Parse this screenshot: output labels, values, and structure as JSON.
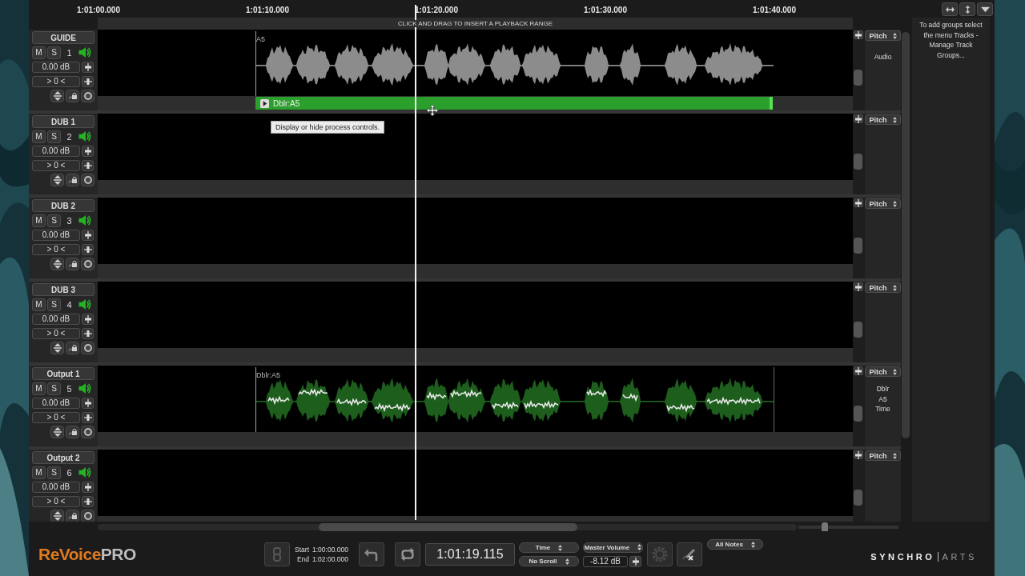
{
  "ruler": {
    "ticks": [
      "1:01:00.000",
      "1:01:10.000",
      "1:01:20.000",
      "1:01:30.000",
      "1:01:40.000"
    ],
    "hint": "CLICK AND DRAG TO INSERT A PLAYBACK RANGE"
  },
  "tracks": [
    {
      "name": "GUIDE",
      "mute": "M",
      "solo": "S",
      "muted": false,
      "soloed": false,
      "number": "1",
      "gain": "0.00 dB",
      "pan": "> 0 <",
      "process": "Pitch",
      "process_lines": [
        "Audio"
      ],
      "clip": {
        "kind": "guide",
        "label": "A5",
        "process_bar": "Dblr:A5"
      }
    },
    {
      "name": "DUB 1",
      "mute": "M",
      "solo": "S",
      "muted": false,
      "soloed": false,
      "number": "2",
      "gain": "0.00 dB",
      "pan": "> 0 <",
      "process": "Pitch"
    },
    {
      "name": "DUB 2",
      "mute": "M",
      "solo": "S",
      "muted": false,
      "soloed": false,
      "number": "3",
      "gain": "0.00 dB",
      "pan": "> 0 <",
      "process": "Pitch"
    },
    {
      "name": "DUB 3",
      "mute": "M",
      "solo": "S",
      "muted": false,
      "soloed": false,
      "number": "4",
      "gain": "0.00 dB",
      "pan": "> 0 <",
      "process": "Pitch"
    },
    {
      "name": "Output 1",
      "mute": "M",
      "solo": "S",
      "muted": false,
      "soloed": false,
      "number": "5",
      "gain": "0.00 dB",
      "pan": "> 0 <",
      "process": "Pitch",
      "process_lines": [
        "Dblr",
        "A5",
        "Time"
      ],
      "clip": {
        "kind": "output",
        "label": "Dblr:A5"
      }
    },
    {
      "name": "Output 2",
      "mute": "M",
      "solo": "S",
      "muted": false,
      "soloed": false,
      "number": "6",
      "gain": "0.00 dB",
      "pan": "> 0 <",
      "process": "Pitch"
    }
  ],
  "tooltip": "Display or hide process controls.",
  "groups_panel": {
    "message": "To add groups select the menu Tracks - Manage Track Groups..."
  },
  "zoom": {
    "level": 0.26
  },
  "transport": {
    "logo_main": "ReVoice",
    "logo_pro": "PRO",
    "start_label": "Start",
    "start": "1:00:00.000",
    "end_label": "End",
    "end": "1:02:00.000",
    "time": "1:01:19.115",
    "display_mode": "Time",
    "scroll_mode": "No Scroll",
    "volume_label": "Master Volume",
    "master_volume": "-8.12 dB",
    "notes_filter": "All Notes"
  },
  "brand": {
    "bold": "SYNCHRO",
    "light": "ARTS"
  }
}
